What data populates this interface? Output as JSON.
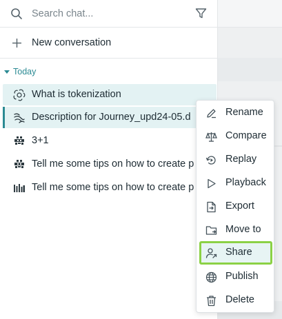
{
  "search": {
    "placeholder": "Search chat..."
  },
  "new_conversation": {
    "label": "New conversation"
  },
  "section": {
    "label": "Today"
  },
  "conversations": [
    {
      "title": "What is tokenization",
      "icon": "openai-icon"
    },
    {
      "title": "Description for Journey_upd24-05.d",
      "icon": "waveform-icon"
    },
    {
      "title": "3+1",
      "icon": "robot-icon"
    },
    {
      "title": "Tell me some tips on how to create p",
      "icon": "robot-icon"
    },
    {
      "title": "Tell me some tips on how to create p",
      "icon": "bar-logo-icon"
    }
  ],
  "menu": {
    "items": [
      {
        "label": "Rename",
        "icon": "pencil-icon"
      },
      {
        "label": "Compare",
        "icon": "scale-icon"
      },
      {
        "label": "Replay",
        "icon": "replay-icon"
      },
      {
        "label": "Playback",
        "icon": "play-icon"
      },
      {
        "label": "Export",
        "icon": "export-icon"
      },
      {
        "label": "Move to",
        "icon": "folder-icon"
      },
      {
        "label": "Share",
        "icon": "share-user-icon"
      },
      {
        "label": "Publish",
        "icon": "globe-icon"
      },
      {
        "label": "Delete",
        "icon": "trash-icon"
      }
    ]
  },
  "colors": {
    "accent": "#2b8a93",
    "highlight_border": "#8bd145",
    "active_bg": "#e3f2f3"
  }
}
